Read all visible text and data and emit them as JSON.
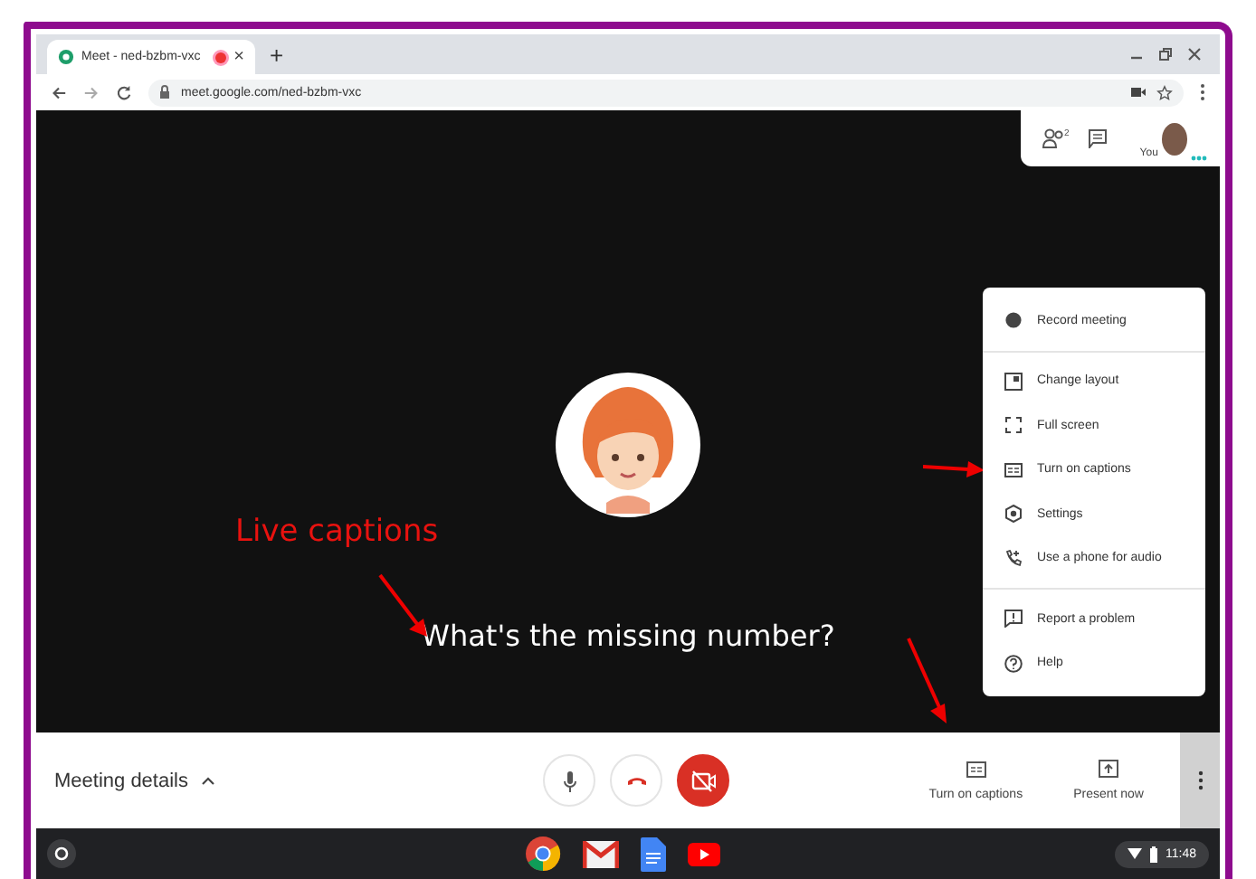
{
  "browser": {
    "tab": {
      "title": "Meet - ned-bzbm-vxc",
      "recording": true,
      "close": "×",
      "selected": true
    },
    "new_tab": "+",
    "address": "meet.google.com/ned-bzbm-vxc"
  },
  "top_panel": {
    "people_count": "2",
    "self_label": "You"
  },
  "stage": {
    "caption": "What's the missing number?"
  },
  "menu": {
    "groups": [
      [
        {
          "label": "Record meeting",
          "kind": "record"
        }
      ],
      [
        {
          "label": "Change layout",
          "kind": "layout"
        },
        {
          "label": "Full screen",
          "kind": "fullscreen"
        },
        {
          "label": "Turn on captions",
          "kind": "captions"
        },
        {
          "label": "Settings",
          "kind": "settings"
        },
        {
          "label": "Use a phone for audio",
          "kind": "phone"
        }
      ],
      [
        {
          "label": "Report a problem",
          "kind": "report"
        },
        {
          "label": "Help",
          "kind": "help"
        }
      ]
    ]
  },
  "annotation": {
    "label": "Live captions"
  },
  "bottom_bar": {
    "meeting_details": "Meeting details",
    "actions": [
      {
        "label": "Turn on captions",
        "kind": "captions"
      },
      {
        "label": "Present now",
        "kind": "present"
      }
    ]
  },
  "shelf": {
    "time": "11:48"
  }
}
